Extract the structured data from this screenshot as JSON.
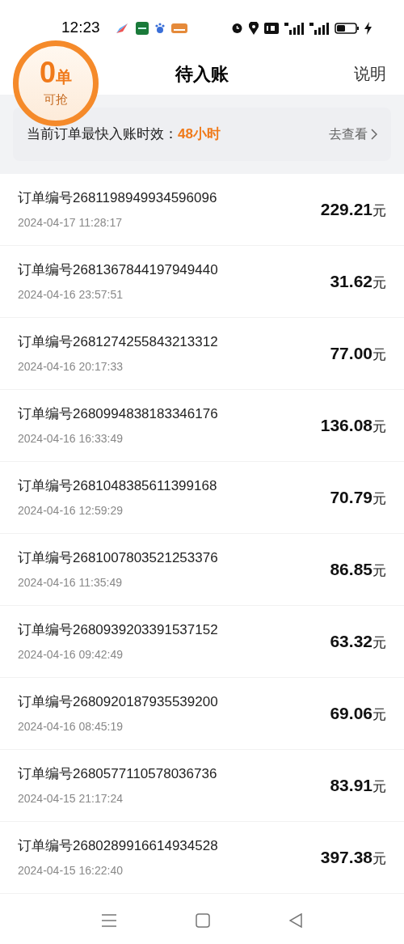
{
  "status_bar": {
    "time": "12:23"
  },
  "header": {
    "title": "待入账",
    "action": "说明"
  },
  "badge": {
    "count": "0",
    "unit": "单",
    "caption": "可抢"
  },
  "banner": {
    "label": "当前订单最快入账时效：",
    "value": "48小时",
    "link": "去查看"
  },
  "orders": [
    {
      "number": "订单编号2681198949934596096",
      "time": "2024-04-17 11:28:17",
      "amount": "229.21",
      "currency": "元"
    },
    {
      "number": "订单编号2681367844197949440",
      "time": "2024-04-16 23:57:51",
      "amount": "31.62",
      "currency": "元"
    },
    {
      "number": "订单编号2681274255843213312",
      "time": "2024-04-16 20:17:33",
      "amount": "77.00",
      "currency": "元"
    },
    {
      "number": "订单编号2680994838183346176",
      "time": "2024-04-16 16:33:49",
      "amount": "136.08",
      "currency": "元"
    },
    {
      "number": "订单编号2681048385611399168",
      "time": "2024-04-16 12:59:29",
      "amount": "70.79",
      "currency": "元"
    },
    {
      "number": "订单编号2681007803521253376",
      "time": "2024-04-16 11:35:49",
      "amount": "86.85",
      "currency": "元"
    },
    {
      "number": "订单编号2680939203391537152",
      "time": "2024-04-16 09:42:49",
      "amount": "63.32",
      "currency": "元"
    },
    {
      "number": "订单编号2680920187935539200",
      "time": "2024-04-16 08:45:19",
      "amount": "69.06",
      "currency": "元"
    },
    {
      "number": "订单编号2680577110578036736",
      "time": "2024-04-15 21:17:24",
      "amount": "83.91",
      "currency": "元"
    },
    {
      "number": "订单编号2680289916614934528",
      "time": "2024-04-15 16:22:40",
      "amount": "397.38",
      "currency": "元"
    }
  ]
}
